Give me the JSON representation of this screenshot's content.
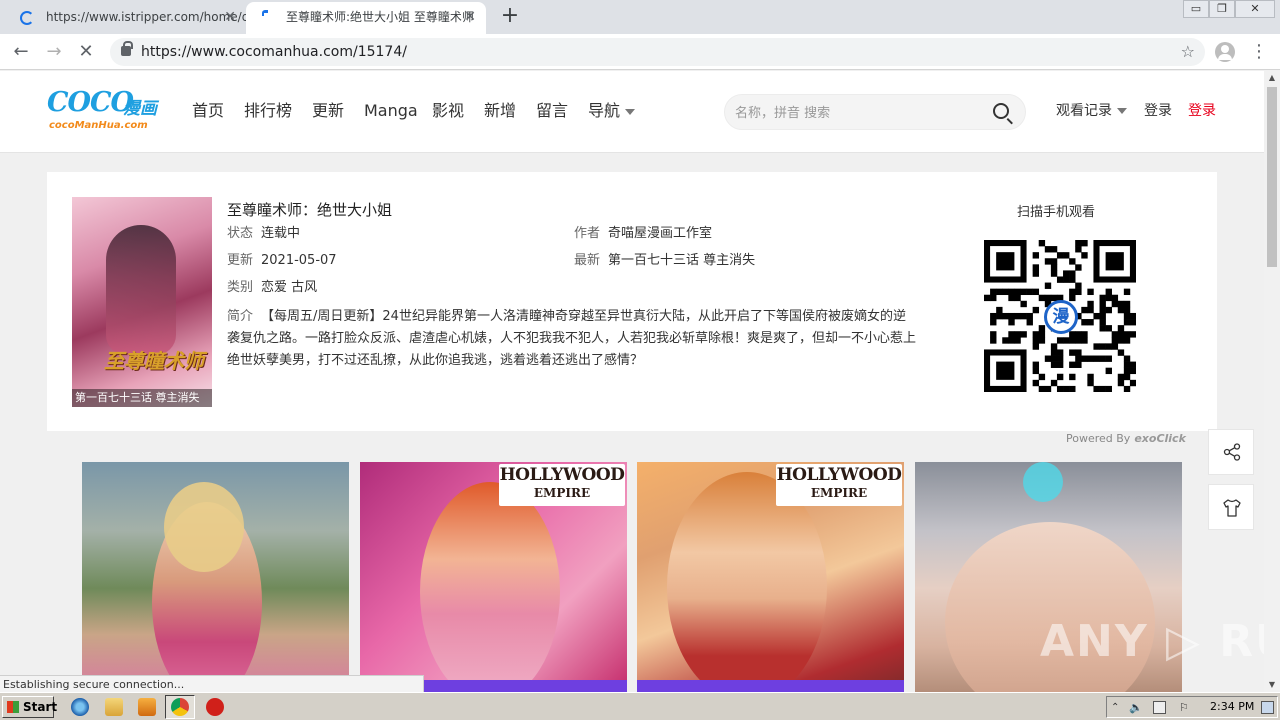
{
  "browser": {
    "tabs": [
      {
        "title": "https://www.istripper.com/home/dir",
        "loading": true
      },
      {
        "title": "至尊瞳术师:绝世大小姐 至尊瞳术师",
        "active": true
      }
    ],
    "new_tab": "+",
    "window_controls": {
      "minimize": "▭",
      "restore": "❐",
      "close": "✕"
    },
    "url": "https://www.cocomanhua.com/15174/"
  },
  "site": {
    "logo": {
      "main": "COCO",
      "cn": "漫画",
      "sub": "cocoManHua.com"
    },
    "nav": [
      "首页",
      "排行榜",
      "更新",
      "Manga",
      "影视",
      "新增",
      "留言",
      "导航"
    ],
    "search": {
      "placeholder": "名称，拼音 搜索"
    },
    "history": "观看记录",
    "login": "登录",
    "register": "登录"
  },
  "comic": {
    "title": "至尊瞳术师：绝世大小姐",
    "cover_title": "至尊瞳术师",
    "cover_caption": "第一百七十三话 尊主消失",
    "status_label": "状态",
    "status": "连载中",
    "author_label": "作者",
    "author": "奇喵屋漫画工作室",
    "updated_label": "更新",
    "updated": "2021-05-07",
    "latest_label": "最新",
    "latest": "第一百七十三话 尊主消失",
    "genre_label": "类别",
    "genre": "恋爱 古风",
    "intro_label": "简介",
    "intro": "【每周五/周日更新】24世纪异能界第一人洛清瞳神奇穿越至异世真衍大陆，从此开启了下等国侯府被废嫡女的逆袭复仇之路。一路打脸众反派、虐渣虐心机婊，人不犯我我不犯人，人若犯我必斩草除根！爽是爽了，但却一不小心惹上绝世妖孽美男，打不过还乱撩，从此你追我逃，逃着逃着还逃出了感情？",
    "qr_title": "扫描手机观看",
    "qr_badge": "漫"
  },
  "ads": {
    "powered_by": "Powered By",
    "powered_brand": "exoClick",
    "logo_line1": "HOLLYWOOD",
    "logo_line2": "EMPIRE"
  },
  "watermark": "ANY ▷ RUN",
  "status_text": "Establishing secure connection...",
  "taskbar": {
    "start": "Start",
    "clock": "2:34 PM"
  }
}
